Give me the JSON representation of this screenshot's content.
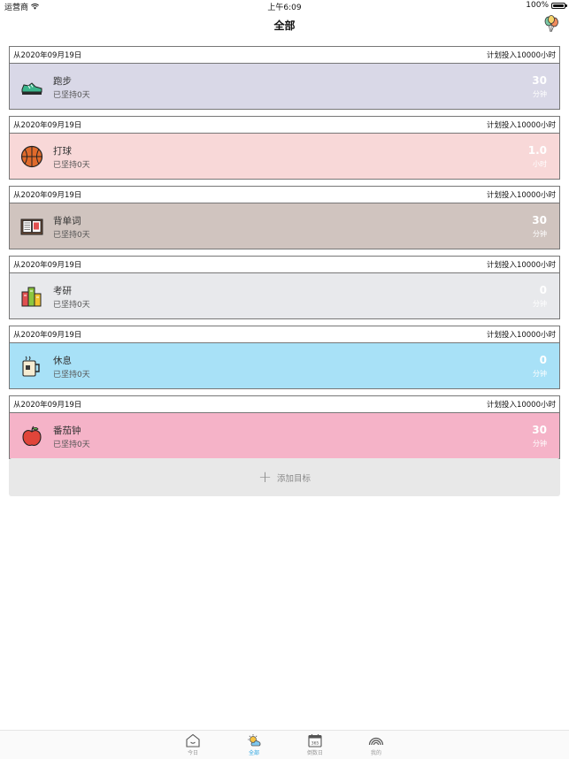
{
  "status_bar": {
    "carrier": "运营商",
    "time": "上午6:09",
    "battery": "100%"
  },
  "nav": {
    "title": "全部",
    "right_icon": "balloons-icon"
  },
  "goals": [
    {
      "since": "从2020年09月19日",
      "plan": "计划投入10000小时",
      "name": "跑步",
      "days": "已坚持0天",
      "value": "30",
      "unit": "分钟",
      "icon": "sneaker-icon",
      "color": "#d9d8e7"
    },
    {
      "since": "从2020年09月19日",
      "plan": "计划投入10000小时",
      "name": "打球",
      "days": "已坚持0天",
      "value": "1.0",
      "unit": "小时",
      "icon": "basketball-icon",
      "color": "#f8d8d8"
    },
    {
      "since": "从2020年09月19日",
      "plan": "计划投入10000小时",
      "name": "背单词",
      "days": "已坚持0天",
      "value": "30",
      "unit": "分钟",
      "icon": "book-icon",
      "color": "#d0c4bf"
    },
    {
      "since": "从2020年09月19日",
      "plan": "计划投入10000小时",
      "name": "考研",
      "days": "已坚持0天",
      "value": "0",
      "unit": "分钟",
      "icon": "books-icon",
      "color": "#e8e9ec"
    },
    {
      "since": "从2020年09月19日",
      "plan": "计划投入10000小时",
      "name": "休息",
      "days": "已坚持0天",
      "value": "0",
      "unit": "分钟",
      "icon": "coffee-mug-icon",
      "color": "#a8e1f7"
    },
    {
      "since": "从2020年09月19日",
      "plan": "计划投入10000小时",
      "name": "番茄钟",
      "days": "已坚持0天",
      "value": "30",
      "unit": "分钟",
      "icon": "apple-icon",
      "color": "#f5b3c8"
    }
  ],
  "add_goal": {
    "label": "添加目标"
  },
  "tabs": [
    {
      "label": "今日",
      "icon": "home-icon",
      "active": false
    },
    {
      "label": "全部",
      "icon": "sun-cloud-icon",
      "active": true
    },
    {
      "label": "倒数日",
      "icon": "calendar-365-icon",
      "active": false
    },
    {
      "label": "我的",
      "icon": "rainbow-icon",
      "active": false
    }
  ],
  "colors": {
    "accent": "#29a3e0",
    "add_bg": "#e8e8e8"
  }
}
